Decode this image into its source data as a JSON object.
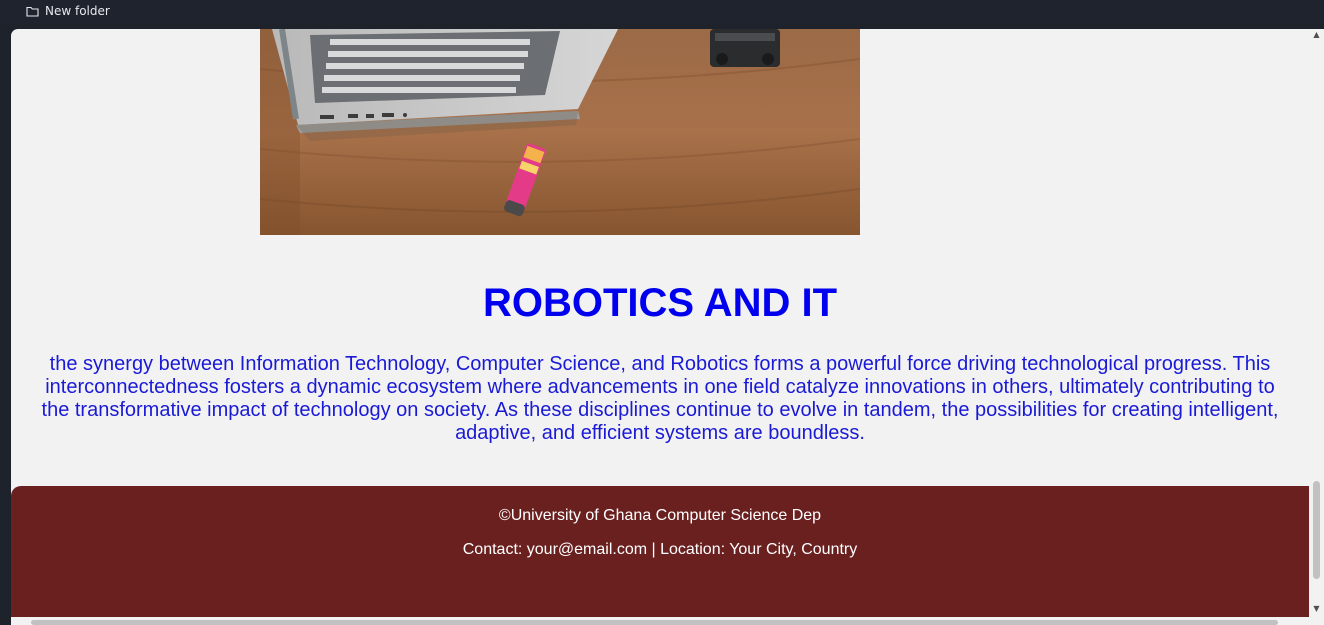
{
  "bookmarks_bar": {
    "items": [
      {
        "label": "New folder",
        "icon": "folder-icon"
      }
    ]
  },
  "page": {
    "hero_image": {
      "alt": "laptop-and-robot-on-wooden-desk"
    },
    "heading": "ROBOTICS AND IT",
    "paragraph": "the synergy between Information Technology, Computer Science, and Robotics forms a powerful force driving technological progress. This interconnectedness fosters a dynamic ecosystem where advancements in one field catalyze innovations in others, ultimately contributing to the transformative impact of technology on society. As these disciplines continue to evolve in tandem, the possibilities for creating intelligent, adaptive, and efficient systems are boundless.",
    "colors": {
      "heading": "#0000ee",
      "paragraph": "#1a1ad6",
      "footer_bg": "#6b2020",
      "background": "#f2f2f2"
    }
  },
  "footer": {
    "copyright": "©University of Ghana Computer Science Dep",
    "contact": "Contact: your@email.com | Location: Your City, Country"
  }
}
